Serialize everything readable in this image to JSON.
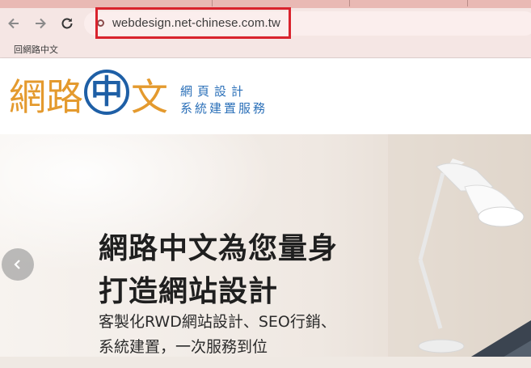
{
  "browser": {
    "nav": {
      "back_icon": "arrow-left-icon",
      "forward_icon": "arrow-right-icon",
      "reload_icon": "reload-icon"
    },
    "address_bar": {
      "url": "webdesign.net-chinese.com.tw",
      "site_info_icon": "site-info-icon"
    },
    "bookmarks": [
      {
        "label": "回網路中文"
      }
    ],
    "colors": {
      "highlight": "#d9232d",
      "chrome": "#f5e6e4"
    }
  },
  "site": {
    "logo": {
      "char1": "網",
      "char2": "路",
      "circle_char": "中",
      "char4": "文"
    },
    "tagline": {
      "line1": "網頁設計",
      "line2": "系統建置服務"
    },
    "colors": {
      "logo_orange": "#e49a2e",
      "logo_blue": "#1e5fa6",
      "tagline_blue": "#2a6fb8"
    }
  },
  "hero": {
    "title_line1": "網路中文為您量身",
    "title_line2": "打造網站設計",
    "subtitle_line1": "客製化RWD網站設計、SEO行銷、",
    "subtitle_line2": "系統建置，一次服務到位",
    "prev_icon": "chevron-left-icon"
  }
}
